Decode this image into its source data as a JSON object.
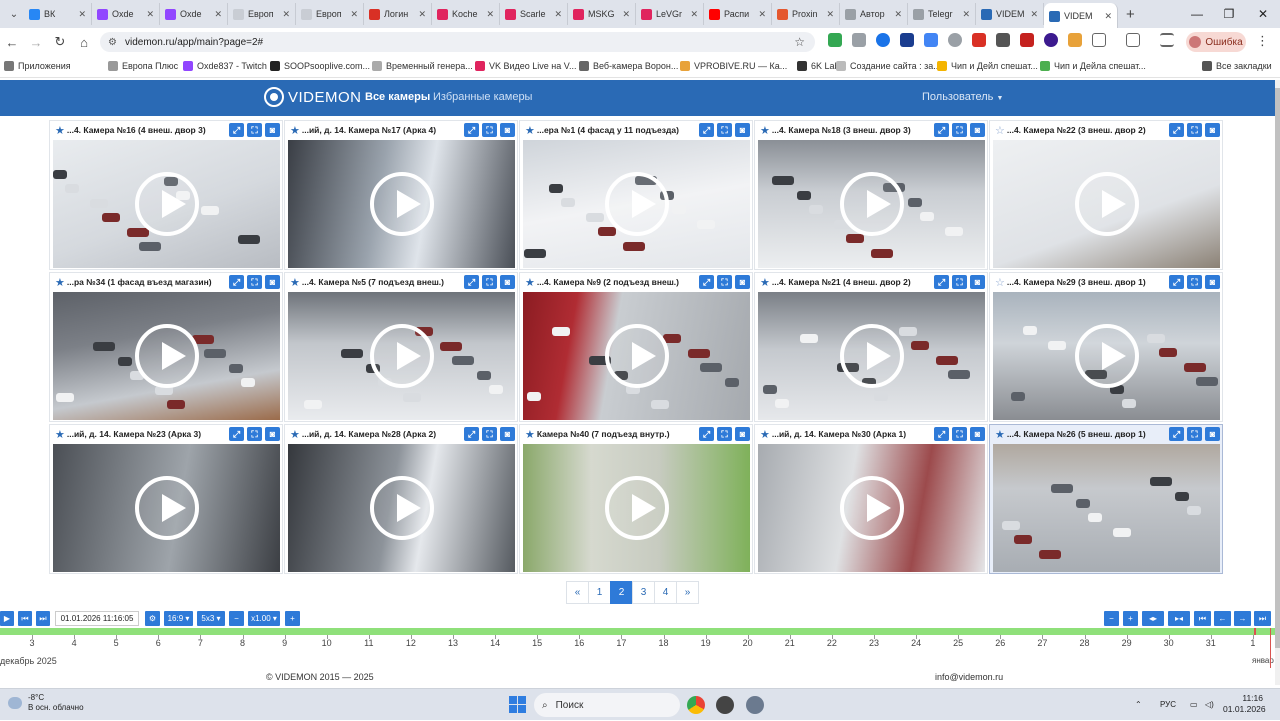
{
  "browser": {
    "tabs": [
      {
        "label": "ВК",
        "color": "#2787f5"
      },
      {
        "label": "Oxde",
        "color": "#9146ff"
      },
      {
        "label": "Oxde",
        "color": "#9146ff"
      },
      {
        "label": "Европ",
        "color": "#c9cdd4"
      },
      {
        "label": "Европ",
        "color": "#c9cdd4"
      },
      {
        "label": "Логин",
        "color": "#d93025"
      },
      {
        "label": "Koche",
        "color": "#e0245e"
      },
      {
        "label": "Scarle",
        "color": "#e0245e"
      },
      {
        "label": "MSKG",
        "color": "#e0245e"
      },
      {
        "label": "LeVGr",
        "color": "#e0245e"
      },
      {
        "label": "Распи",
        "color": "#ff0000"
      },
      {
        "label": "Proxin",
        "color": "#e4572e"
      },
      {
        "label": "Автор",
        "color": "#9aa0a6"
      },
      {
        "label": "Telegr",
        "color": "#9aa0a6"
      },
      {
        "label": "VIDEM",
        "color": "#2a6ab5"
      },
      {
        "label": "VIDEM",
        "color": "#2a6ab5"
      }
    ],
    "url": "videmon.ru/app/main?page=2#",
    "error_label": "Ошибка",
    "bookmarks": [
      "Приложения",
      "Европа Плюс",
      "Oxde837 - Twitch",
      "SOOPsooplive.com...",
      "Временный генера...",
      "VK Видео Live на V...",
      "Веб-камера Ворон...",
      "VPROBIVE.RU — Ка...",
      "6K Labs",
      "Создание сайта : за...",
      "Чип и Дейл спешат...",
      "Чип и Дейла спешат...",
      "Все закладки"
    ]
  },
  "app": {
    "logo_text": "VIDEMON",
    "nav_all": "Все камеры",
    "nav_favorites": "Избранные камеры",
    "user_menu": "Пользователь"
  },
  "cameras": [
    {
      "title": "...4. Камера №16 (4 внеш. двор 3)",
      "fav": true
    },
    {
      "title": "...ий, д. 14. Камера №17 (Арка 4)",
      "fav": true
    },
    {
      "title": "...ера №1 (4 фасад у 11 подъезда)",
      "fav": true
    },
    {
      "title": "...4. Камера №18 (3 внеш. двор 3)",
      "fav": true
    },
    {
      "title": "...4. Камера №22 (3 внеш. двор 2)",
      "fav": false
    },
    {
      "title": "...ра №34 (1 фасад въезд магазин)",
      "fav": true
    },
    {
      "title": "...4. Камера №5 (7 подъезд внеш.)",
      "fav": true
    },
    {
      "title": "...4. Камера №9 (2 подъезд внеш.)",
      "fav": true
    },
    {
      "title": "...4. Камера №21 (4 внеш. двор 2)",
      "fav": true
    },
    {
      "title": "...4. Камера №29 (3 внеш. двор 1)",
      "fav": false
    },
    {
      "title": "...ий, д. 14. Камера №23 (Арка 3)",
      "fav": true
    },
    {
      "title": "...ий, д. 14. Камера №28 (Арка 2)",
      "fav": true
    },
    {
      "title": "Камера №40 (7 подъезд внутр.)",
      "fav": true
    },
    {
      "title": "...ий, д. 14. Камера №30 (Арка 1)",
      "fav": true
    },
    {
      "title": "...4. Камера №26 (5 внеш. двор 1)",
      "fav": true
    }
  ],
  "pagination": {
    "prev": "«",
    "pages": [
      "1",
      "2",
      "3",
      "4"
    ],
    "current": "2",
    "next": "»"
  },
  "timeline": {
    "datetime": "01.01.2026 11:16:05",
    "aspect": "16:9",
    "layout": "5x3",
    "speed": "x1.00",
    "days": [
      "3",
      "4",
      "5",
      "6",
      "7",
      "8",
      "9",
      "10",
      "11",
      "12",
      "13",
      "14",
      "15",
      "16",
      "17",
      "18",
      "19",
      "20",
      "21",
      "22",
      "23",
      "24",
      "25",
      "26",
      "27",
      "28",
      "29",
      "30",
      "31",
      "1"
    ],
    "month_label": "декабрь 2025",
    "month_label_next": "январ"
  },
  "footer": {
    "copyright": "© VIDEMON 2015 — 2025",
    "email": "info@videmon.ru"
  },
  "taskbar": {
    "temp": "-8°C",
    "weather": "В осн. облачно",
    "search": "Поиск",
    "lang": "РУС",
    "time": "11:16",
    "date": "01.01.2026"
  }
}
